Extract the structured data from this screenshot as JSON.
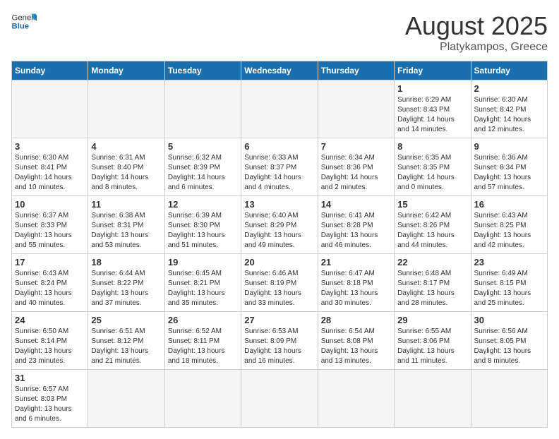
{
  "header": {
    "logo_general": "General",
    "logo_blue": "Blue",
    "title": "August 2025",
    "subtitle": "Platykampos, Greece"
  },
  "days_of_week": [
    "Sunday",
    "Monday",
    "Tuesday",
    "Wednesday",
    "Thursday",
    "Friday",
    "Saturday"
  ],
  "weeks": [
    [
      {
        "day": "",
        "info": ""
      },
      {
        "day": "",
        "info": ""
      },
      {
        "day": "",
        "info": ""
      },
      {
        "day": "",
        "info": ""
      },
      {
        "day": "",
        "info": ""
      },
      {
        "day": "1",
        "info": "Sunrise: 6:29 AM\nSunset: 8:43 PM\nDaylight: 14 hours and 14 minutes."
      },
      {
        "day": "2",
        "info": "Sunrise: 6:30 AM\nSunset: 8:42 PM\nDaylight: 14 hours and 12 minutes."
      }
    ],
    [
      {
        "day": "3",
        "info": "Sunrise: 6:30 AM\nSunset: 8:41 PM\nDaylight: 14 hours and 10 minutes."
      },
      {
        "day": "4",
        "info": "Sunrise: 6:31 AM\nSunset: 8:40 PM\nDaylight: 14 hours and 8 minutes."
      },
      {
        "day": "5",
        "info": "Sunrise: 6:32 AM\nSunset: 8:39 PM\nDaylight: 14 hours and 6 minutes."
      },
      {
        "day": "6",
        "info": "Sunrise: 6:33 AM\nSunset: 8:37 PM\nDaylight: 14 hours and 4 minutes."
      },
      {
        "day": "7",
        "info": "Sunrise: 6:34 AM\nSunset: 8:36 PM\nDaylight: 14 hours and 2 minutes."
      },
      {
        "day": "8",
        "info": "Sunrise: 6:35 AM\nSunset: 8:35 PM\nDaylight: 14 hours and 0 minutes."
      },
      {
        "day": "9",
        "info": "Sunrise: 6:36 AM\nSunset: 8:34 PM\nDaylight: 13 hours and 57 minutes."
      }
    ],
    [
      {
        "day": "10",
        "info": "Sunrise: 6:37 AM\nSunset: 8:33 PM\nDaylight: 13 hours and 55 minutes."
      },
      {
        "day": "11",
        "info": "Sunrise: 6:38 AM\nSunset: 8:31 PM\nDaylight: 13 hours and 53 minutes."
      },
      {
        "day": "12",
        "info": "Sunrise: 6:39 AM\nSunset: 8:30 PM\nDaylight: 13 hours and 51 minutes."
      },
      {
        "day": "13",
        "info": "Sunrise: 6:40 AM\nSunset: 8:29 PM\nDaylight: 13 hours and 49 minutes."
      },
      {
        "day": "14",
        "info": "Sunrise: 6:41 AM\nSunset: 8:28 PM\nDaylight: 13 hours and 46 minutes."
      },
      {
        "day": "15",
        "info": "Sunrise: 6:42 AM\nSunset: 8:26 PM\nDaylight: 13 hours and 44 minutes."
      },
      {
        "day": "16",
        "info": "Sunrise: 6:43 AM\nSunset: 8:25 PM\nDaylight: 13 hours and 42 minutes."
      }
    ],
    [
      {
        "day": "17",
        "info": "Sunrise: 6:43 AM\nSunset: 8:24 PM\nDaylight: 13 hours and 40 minutes."
      },
      {
        "day": "18",
        "info": "Sunrise: 6:44 AM\nSunset: 8:22 PM\nDaylight: 13 hours and 37 minutes."
      },
      {
        "day": "19",
        "info": "Sunrise: 6:45 AM\nSunset: 8:21 PM\nDaylight: 13 hours and 35 minutes."
      },
      {
        "day": "20",
        "info": "Sunrise: 6:46 AM\nSunset: 8:19 PM\nDaylight: 13 hours and 33 minutes."
      },
      {
        "day": "21",
        "info": "Sunrise: 6:47 AM\nSunset: 8:18 PM\nDaylight: 13 hours and 30 minutes."
      },
      {
        "day": "22",
        "info": "Sunrise: 6:48 AM\nSunset: 8:17 PM\nDaylight: 13 hours and 28 minutes."
      },
      {
        "day": "23",
        "info": "Sunrise: 6:49 AM\nSunset: 8:15 PM\nDaylight: 13 hours and 25 minutes."
      }
    ],
    [
      {
        "day": "24",
        "info": "Sunrise: 6:50 AM\nSunset: 8:14 PM\nDaylight: 13 hours and 23 minutes."
      },
      {
        "day": "25",
        "info": "Sunrise: 6:51 AM\nSunset: 8:12 PM\nDaylight: 13 hours and 21 minutes."
      },
      {
        "day": "26",
        "info": "Sunrise: 6:52 AM\nSunset: 8:11 PM\nDaylight: 13 hours and 18 minutes."
      },
      {
        "day": "27",
        "info": "Sunrise: 6:53 AM\nSunset: 8:09 PM\nDaylight: 13 hours and 16 minutes."
      },
      {
        "day": "28",
        "info": "Sunrise: 6:54 AM\nSunset: 8:08 PM\nDaylight: 13 hours and 13 minutes."
      },
      {
        "day": "29",
        "info": "Sunrise: 6:55 AM\nSunset: 8:06 PM\nDaylight: 13 hours and 11 minutes."
      },
      {
        "day": "30",
        "info": "Sunrise: 6:56 AM\nSunset: 8:05 PM\nDaylight: 13 hours and 8 minutes."
      }
    ],
    [
      {
        "day": "31",
        "info": "Sunrise: 6:57 AM\nSunset: 8:03 PM\nDaylight: 13 hours and 6 minutes."
      },
      {
        "day": "",
        "info": ""
      },
      {
        "day": "",
        "info": ""
      },
      {
        "day": "",
        "info": ""
      },
      {
        "day": "",
        "info": ""
      },
      {
        "day": "",
        "info": ""
      },
      {
        "day": "",
        "info": ""
      }
    ]
  ]
}
